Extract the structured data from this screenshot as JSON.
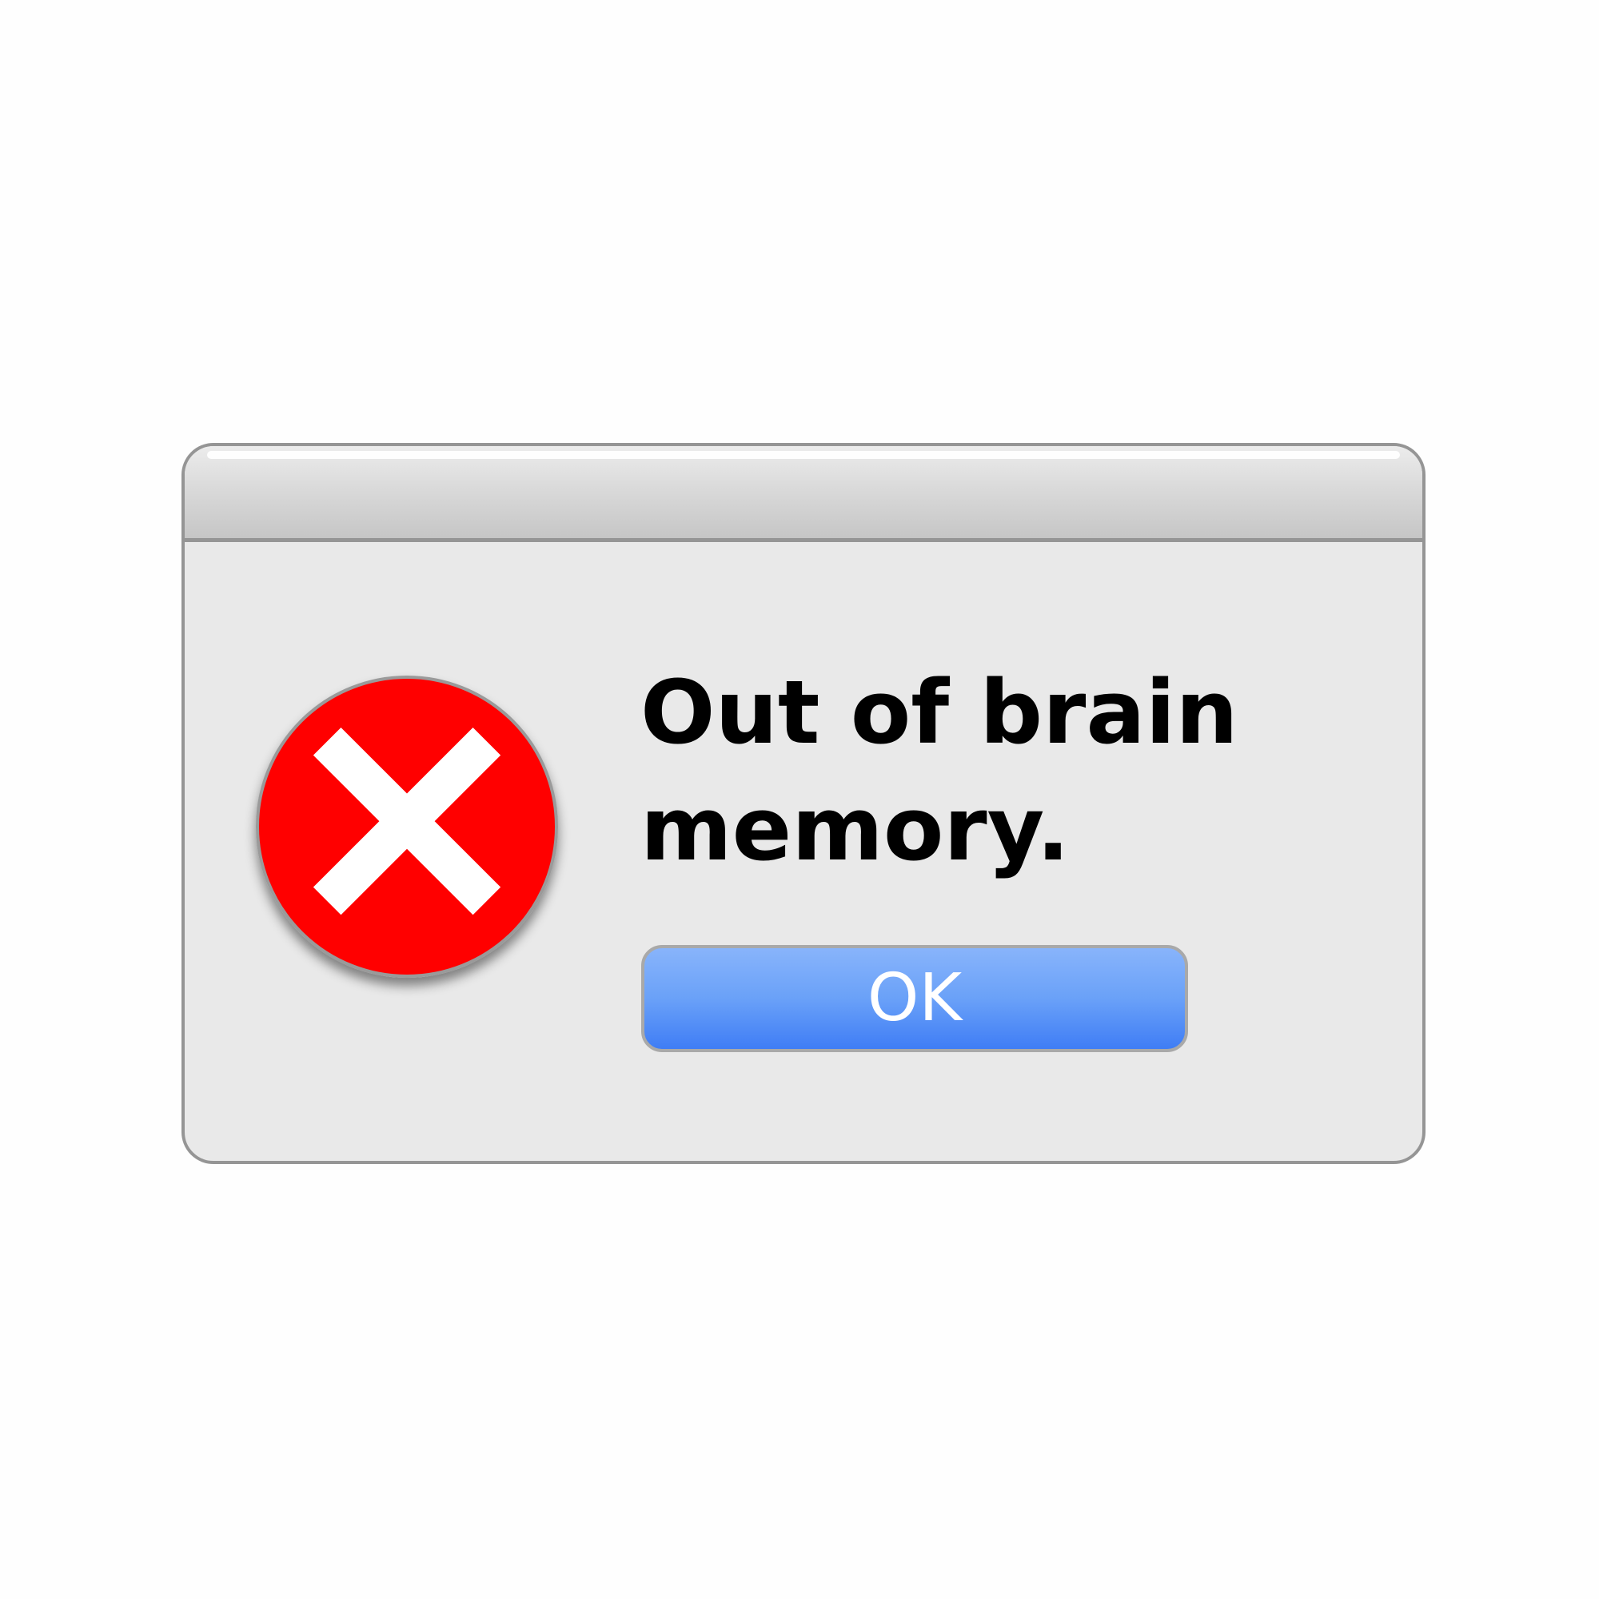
{
  "dialog": {
    "message_line1": "Out of brain",
    "message_line2": "memory.",
    "ok_label": "OK",
    "icon": "error-x-icon"
  },
  "colors": {
    "icon_red": "#ff0000",
    "button_blue_top": "#88b4fb",
    "button_blue_bottom": "#3f7df5",
    "dialog_body": "#e9e9e9",
    "border": "#959595"
  }
}
